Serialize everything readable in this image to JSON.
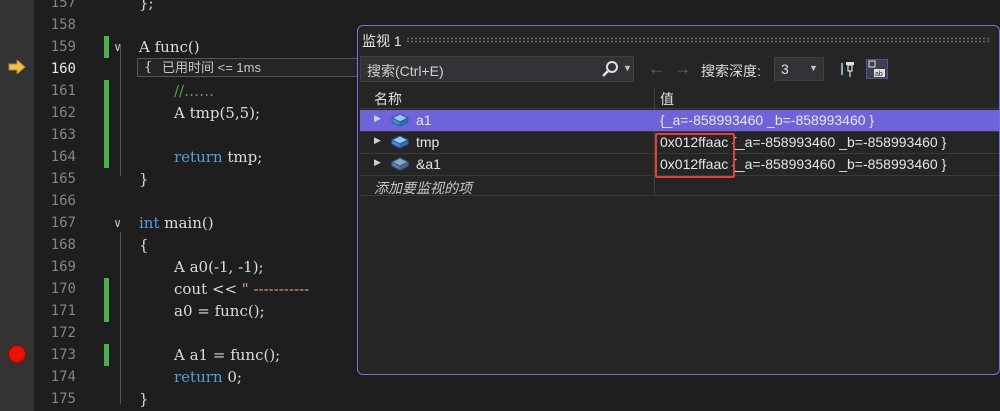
{
  "editor": {
    "current_line": "160",
    "elapsed_text": "已用时间 <= 1ms",
    "lines": [
      {
        "num": "157",
        "code": "};"
      },
      {
        "num": "158",
        "code": ""
      },
      {
        "num": "159",
        "code": "A func()"
      },
      {
        "num": "160",
        "code": "{"
      },
      {
        "num": "161",
        "code": "//……"
      },
      {
        "num": "162",
        "code": "A tmp(5,5);"
      },
      {
        "num": "163",
        "code": ""
      },
      {
        "num": "164",
        "code": "return tmp;"
      },
      {
        "num": "165",
        "code": "}"
      },
      {
        "num": "166",
        "code": ""
      },
      {
        "num": "167",
        "code": "int main()"
      },
      {
        "num": "168",
        "code": "{"
      },
      {
        "num": "169",
        "code": "A a0(-1, -1);"
      },
      {
        "num": "170",
        "code": "cout << \" -----------"
      },
      {
        "num": "171",
        "code": "a0 = func();"
      },
      {
        "num": "172",
        "code": ""
      },
      {
        "num": "173",
        "code": "A a1 = func();"
      },
      {
        "num": "174",
        "code": "return 0;"
      },
      {
        "num": "175",
        "code": "}"
      }
    ],
    "breakpoint_line": "173",
    "colors": {
      "background": "#1e1e1e",
      "keyword": "#569cd6",
      "comment": "#57a64a",
      "breakpoint": "#e51400",
      "change_bar": "#4caf50"
    }
  },
  "watch": {
    "title": "监视 1",
    "search_placeholder": "搜索(Ctrl+E)",
    "search_icon": "search-icon",
    "depth_label": "搜索深度:",
    "depth_value": "3",
    "columns": {
      "name": "名称",
      "value": "值"
    },
    "rows": [
      {
        "name": "a1",
        "value": "{_a=-858993460 _b=-858993460 }",
        "selected": true
      },
      {
        "name": "tmp",
        "addr": "0x012ffaac",
        "value": "{_a=-858993460 _b=-858993460 }"
      },
      {
        "name": "&a1",
        "addr": "0x012ffaac",
        "value": "{_a=-858993460 _b=-858993460 }"
      }
    ],
    "add_item": "添加要监视的项",
    "accent_color": "#6f63d9",
    "highlight_color": "#e04040"
  }
}
